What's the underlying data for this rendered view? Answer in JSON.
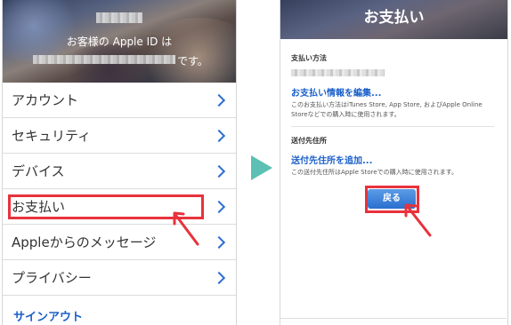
{
  "left_screen": {
    "greeting": "お客様の Apple ID は",
    "suffix": "です。",
    "menu": [
      {
        "label": "アカウント"
      },
      {
        "label": "セキュリティ"
      },
      {
        "label": "デバイス"
      },
      {
        "label": "お支払い"
      },
      {
        "label": "Appleからのメッセージ"
      },
      {
        "label": "プライバシー"
      }
    ],
    "sign_out": "サインアウト"
  },
  "right_screen": {
    "title": "お支払い",
    "payment_method": {
      "heading": "支払い方法",
      "edit_link": "お支払い情報を編集...",
      "note": "このお支払い方法はiTunes Store, App Store, およびApple Online Storeなどでの購入時に使用されます。"
    },
    "shipping": {
      "heading": "送付先住所",
      "add_link": "送付先住所を追加...",
      "note": "この送付先住所はApple Storeでの購入時に使用されます。"
    },
    "back_button": "戻る"
  },
  "colors": {
    "highlight": "#e8323c",
    "link": "#1a5fc9",
    "arrow_triangle": "#5cc0b4",
    "button": "#2a6fd0"
  }
}
